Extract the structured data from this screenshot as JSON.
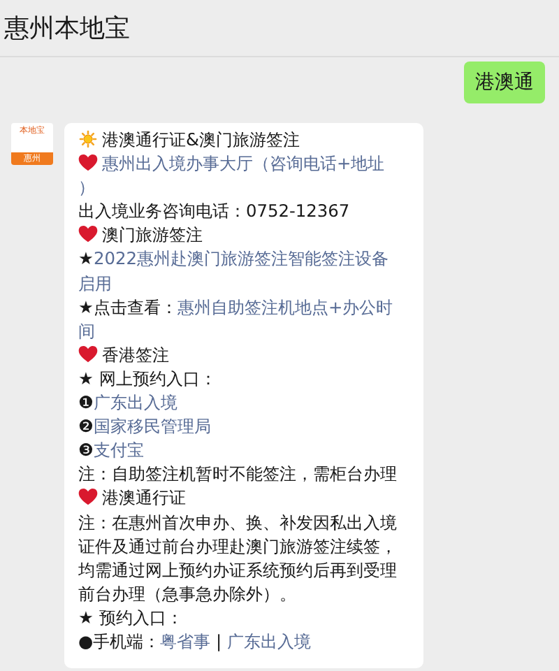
{
  "header": {
    "title": "惠州本地宝"
  },
  "messages": [
    {
      "kind": "sent",
      "text": "港澳通"
    },
    {
      "kind": "received",
      "avatar": {
        "brand": "本地宝",
        "city": "惠州"
      },
      "lines": [
        {
          "kind": "title",
          "parts": [
            {
              "text": "港澳通行证&澳门旅游签注",
              "link": false
            }
          ]
        },
        {
          "kind": "section",
          "parts": [
            {
              "text": "惠州出入境办事大厅（咨询电话+地址",
              "link": true
            }
          ]
        },
        {
          "kind": "text",
          "parts": [
            {
              "text": "）",
              "link": true
            }
          ]
        },
        {
          "kind": "text",
          "parts": [
            {
              "text": "出入境业务咨询电话：0752-12367",
              "link": false
            }
          ]
        },
        {
          "kind": "section",
          "parts": [
            {
              "text": "澳门旅游签注",
              "link": false
            }
          ]
        },
        {
          "kind": "text",
          "parts": [
            {
              "text": "★",
              "link": false
            },
            {
              "text": "2022惠州赴澳门旅游签注智能签注设备",
              "link": true
            }
          ]
        },
        {
          "kind": "text",
          "parts": [
            {
              "text": "启用",
              "link": true
            }
          ]
        },
        {
          "kind": "text",
          "parts": [
            {
              "text": "★点击查看：",
              "link": false
            },
            {
              "text": "惠州自助签注机地点+办公时",
              "link": true
            }
          ]
        },
        {
          "kind": "text",
          "parts": [
            {
              "text": "间",
              "link": true
            }
          ]
        },
        {
          "kind": "section",
          "parts": [
            {
              "text": "香港签注",
              "link": false
            }
          ]
        },
        {
          "kind": "text",
          "parts": [
            {
              "text": "★ 网上预约入口：",
              "link": false
            }
          ]
        },
        {
          "kind": "text",
          "parts": [
            {
              "text": "❶",
              "link": false
            },
            {
              "text": "广东出入境",
              "link": true
            }
          ]
        },
        {
          "kind": "text",
          "parts": [
            {
              "text": "❷",
              "link": false
            },
            {
              "text": "国家移民管理局",
              "link": true
            }
          ]
        },
        {
          "kind": "text",
          "parts": [
            {
              "text": "❸",
              "link": false
            },
            {
              "text": "支付宝",
              "link": true
            }
          ]
        },
        {
          "kind": "text",
          "parts": [
            {
              "text": "注：自助签注机暂时不能签注，需柜台办理",
              "link": false
            }
          ]
        },
        {
          "kind": "section",
          "parts": [
            {
              "text": "港澳通行证",
              "link": false
            }
          ]
        },
        {
          "kind": "text",
          "parts": [
            {
              "text": "注：在惠州首次申办、换、补发因私出入境",
              "link": false
            }
          ]
        },
        {
          "kind": "text",
          "parts": [
            {
              "text": "证件及通过前台办理赴澳门旅游签注续签，",
              "link": false
            }
          ]
        },
        {
          "kind": "text",
          "parts": [
            {
              "text": "均需通过网上预约办证系统预约后再到受理",
              "link": false
            }
          ]
        },
        {
          "kind": "text",
          "parts": [
            {
              "text": "前台办理（急事急办除外）。",
              "link": false
            }
          ]
        },
        {
          "kind": "text",
          "parts": [
            {
              "text": "★ 预约入口：",
              "link": false
            }
          ]
        },
        {
          "kind": "text",
          "parts": [
            {
              "text": "●手机端：",
              "link": false
            },
            {
              "text": "粤省事",
              "link": true
            },
            {
              "text": " | ",
              "link": false
            },
            {
              "text": "广东出入境",
              "link": true
            }
          ]
        }
      ]
    }
  ]
}
